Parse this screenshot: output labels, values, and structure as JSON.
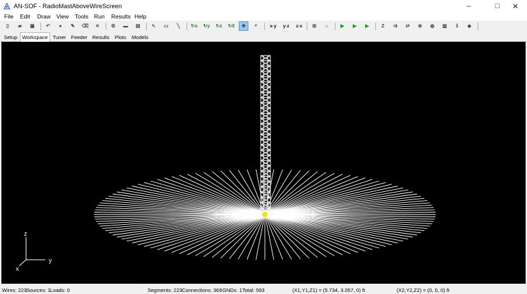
{
  "window": {
    "title": "AN-SOF - RadioMastAboveWireScreen",
    "icon": "an-sof-app-icon"
  },
  "window_controls": [
    "minimize-icon",
    "maximize-icon",
    "close-icon"
  ],
  "menu": [
    "File",
    "Edit",
    "Draw",
    "View",
    "Tools",
    "Run",
    "Results",
    "Help"
  ],
  "toolbar": {
    "items": [
      {
        "name": "new-file-icon",
        "glyph": "▯"
      },
      {
        "name": "open-folder-icon",
        "glyph": "▰"
      },
      {
        "name": "save-icon",
        "glyph": "▣"
      },
      {
        "name": "undo-icon",
        "glyph": "↶"
      },
      {
        "name": "record-icon",
        "glyph": "●"
      },
      {
        "name": "pencil-icon",
        "glyph": "✎"
      },
      {
        "name": "eraser-icon",
        "glyph": "⌫"
      },
      {
        "name": "delete-icon",
        "glyph": "✕"
      },
      {
        "name": "settings-icon",
        "glyph": "⚙"
      },
      {
        "name": "comment-icon",
        "glyph": "▬"
      },
      {
        "name": "properties-icon",
        "glyph": "▤"
      },
      {
        "name": "select-arrow-icon",
        "glyph": "↖"
      },
      {
        "name": "rectangle-select-icon",
        "glyph": "▭"
      },
      {
        "name": "draw-line-icon",
        "glyph": "╲"
      },
      {
        "name": "rotate-x-icon",
        "glyph": "↻x"
      },
      {
        "name": "rotate-y-icon",
        "glyph": "↻y"
      },
      {
        "name": "rotate-z-icon",
        "glyph": "↻z"
      },
      {
        "name": "rotate-z0-icon",
        "glyph": "↻0"
      },
      {
        "name": "pan-icon",
        "glyph": "✥"
      },
      {
        "name": "zoom-icon",
        "glyph": "⌕"
      },
      {
        "name": "view-xy-icon",
        "glyph": "x·y"
      },
      {
        "name": "view-yz-icon",
        "glyph": "y·z"
      },
      {
        "name": "view-zx-icon",
        "glyph": "z·x"
      },
      {
        "name": "fit-view-icon",
        "glyph": "⊞"
      },
      {
        "name": "home-view-icon",
        "glyph": "⌂"
      },
      {
        "name": "run-icon",
        "glyph": "▶"
      },
      {
        "name": "run-currents-icon",
        "glyph": "▶"
      },
      {
        "name": "run-field-icon",
        "glyph": "▶"
      },
      {
        "name": "impedance-icon",
        "glyph": "Z"
      },
      {
        "name": "feed-icon",
        "glyph": "⇉"
      },
      {
        "name": "currents-icon",
        "glyph": "⇄"
      },
      {
        "name": "pattern-3d-icon",
        "glyph": "⊕"
      },
      {
        "name": "pattern-2d-icon",
        "glyph": "◍"
      },
      {
        "name": "chart-icon",
        "glyph": "▥"
      },
      {
        "name": "export-icon",
        "glyph": "⇩"
      },
      {
        "name": "help-book-icon",
        "glyph": "◆"
      }
    ],
    "active": "pan-icon",
    "accent": "#1a9a1a"
  },
  "tabs": [
    "Setup",
    "Workspace",
    "Tuner",
    "Feeder",
    "Results",
    "Plots",
    "Models"
  ],
  "active_tab": "Workspace",
  "axes": {
    "x": "x",
    "y": "y",
    "z": "z"
  },
  "colors": {
    "wire": "#ffffff",
    "source": "#f2e020",
    "background": "#000000"
  },
  "status": {
    "wires": "Wires: 223",
    "sources": "Sources: 1",
    "loads": "Loads: 0",
    "segments": "Segments: 223",
    "connections": "Connections: 369",
    "gnds": "GNDs: 1",
    "total": "Total: 593",
    "point1": "(X1,Y1,Z1) = (5.734, 3.057, 0) ft",
    "point2": "(X2,Y2,Z2) = (0, 0, 0) ft"
  }
}
